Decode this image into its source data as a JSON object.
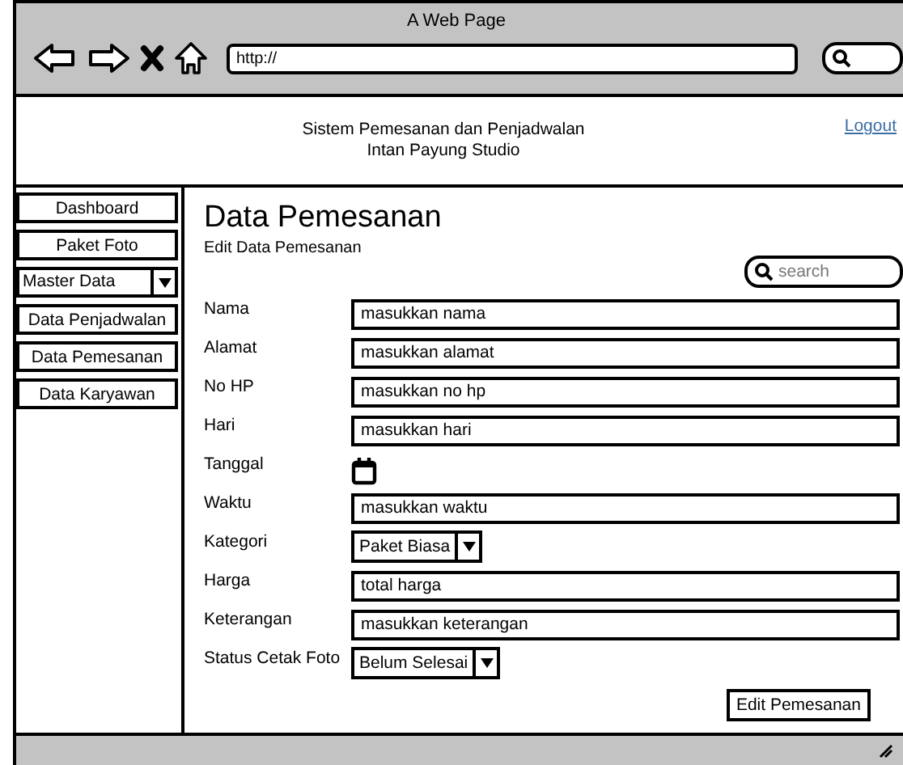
{
  "window": {
    "title": "A Web Page",
    "url": "http://"
  },
  "header": {
    "title_lines": [
      "Sistem Pemesanan dan Penjadwalan",
      "Intan Payung Studio"
    ],
    "logout": "Logout"
  },
  "sidebar": {
    "items": [
      {
        "kind": "button",
        "label": "Dashboard"
      },
      {
        "kind": "button",
        "label": "Paket Foto"
      },
      {
        "kind": "select",
        "label": "Master Data"
      },
      {
        "kind": "button",
        "label": "Data Penjadwalan"
      },
      {
        "kind": "button",
        "label": "Data Pemesanan"
      },
      {
        "kind": "button",
        "label": "Data Karyawan"
      }
    ]
  },
  "main": {
    "title": "Data Pemesanan",
    "subtitle": "Edit Data Pemesanan",
    "search": {
      "placeholder": "search"
    },
    "fields": [
      {
        "kind": "text",
        "label": "Nama",
        "value": "masukkan nama"
      },
      {
        "kind": "text",
        "label": "Alamat",
        "value": "masukkan alamat"
      },
      {
        "kind": "text",
        "label": "No HP",
        "value": "masukkan no hp"
      },
      {
        "kind": "text",
        "label": "Hari",
        "value": "masukkan hari"
      },
      {
        "kind": "date",
        "label": "Tanggal"
      },
      {
        "kind": "text",
        "label": "Waktu",
        "value": "masukkan waktu"
      },
      {
        "kind": "select",
        "label": "Kategori",
        "value": "Paket Biasa"
      },
      {
        "kind": "text",
        "label": "Harga",
        "value": "total harga"
      },
      {
        "kind": "text",
        "label": "Keterangan",
        "value": "masukkan keterangan"
      },
      {
        "kind": "select",
        "label": "Status Cetak Foto",
        "value": "Belum Selesai"
      }
    ],
    "submit": "Edit Pemesanan"
  }
}
